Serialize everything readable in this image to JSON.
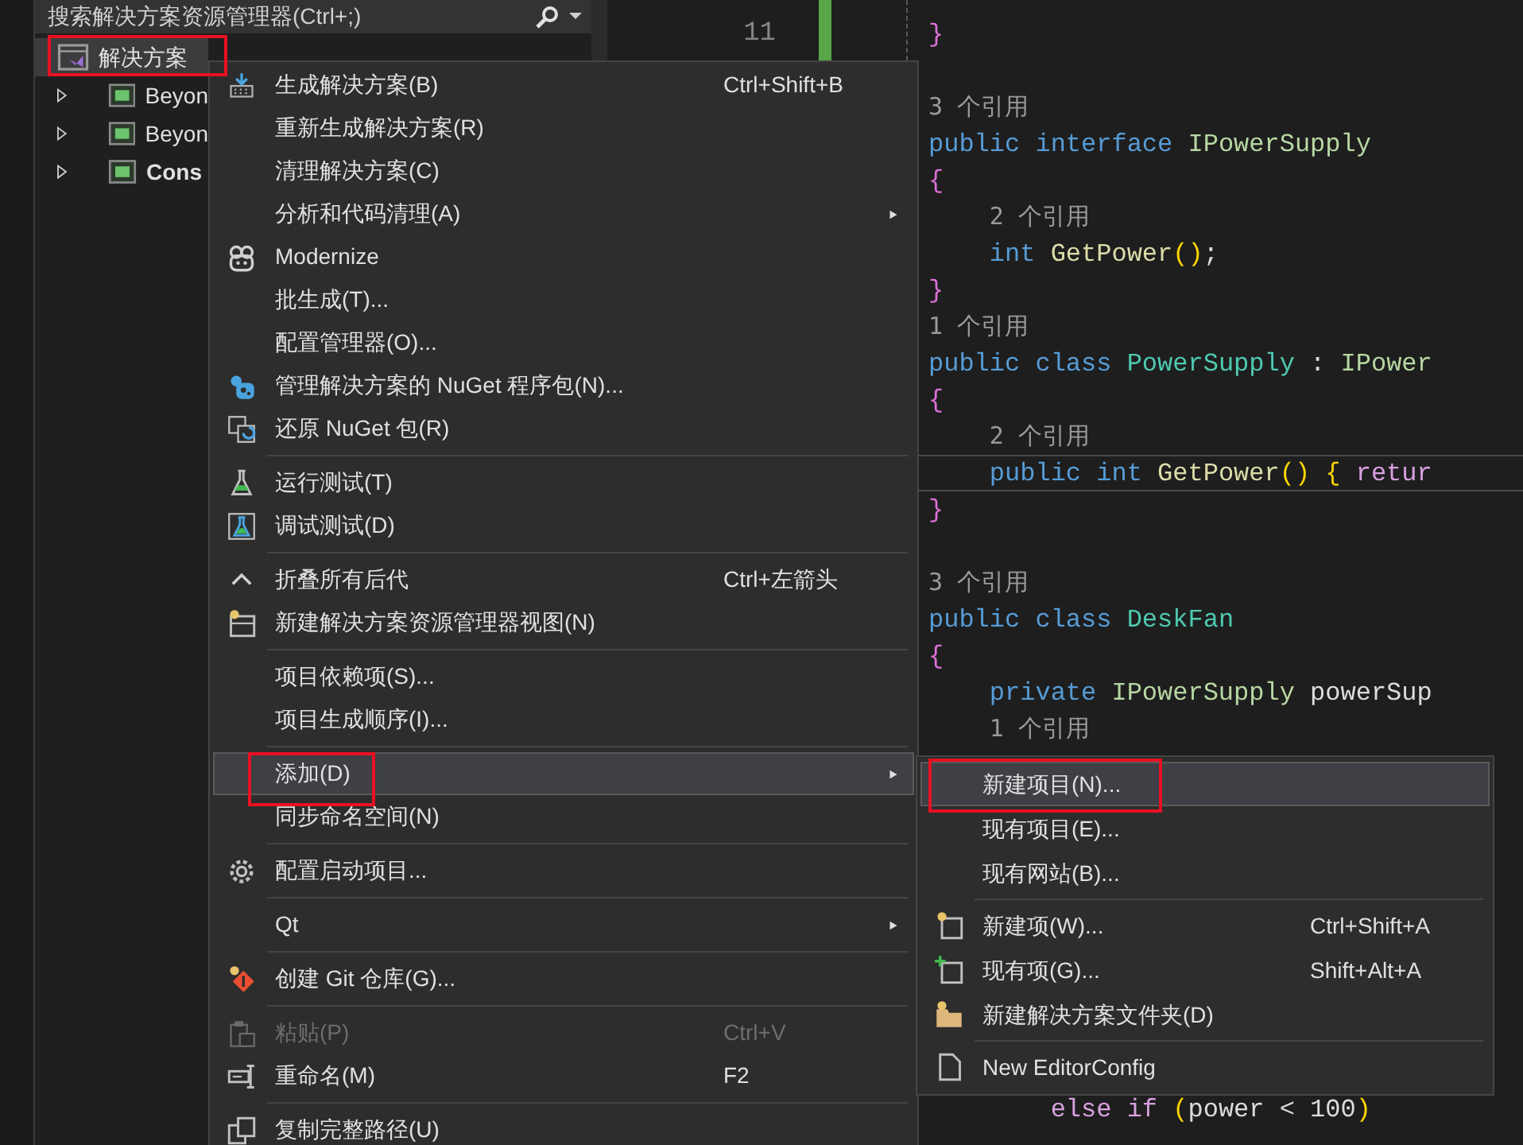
{
  "explorer": {
    "search": {
      "placeholder": "搜索解决方案资源管理器(Ctrl+;)"
    },
    "tree": [
      {
        "label": "解决方案",
        "selected": true,
        "bold": false,
        "children": [
          {
            "label": "Beyon",
            "selected": false,
            "expanded": false,
            "bold": false
          },
          {
            "label": "Beyon",
            "selected": false,
            "expanded": false,
            "bold": false
          },
          {
            "label": "Cons",
            "selected": false,
            "expanded": false,
            "bold": true
          }
        ]
      }
    ]
  },
  "editor": {
    "line_numbers": [
      "11"
    ],
    "lines": [
      {
        "kind": "code",
        "current": false,
        "tokens": [
          {
            "text": "}",
            "kind": "brace"
          }
        ]
      },
      {
        "kind": "blank",
        "current": false
      },
      {
        "kind": "codelens",
        "current": false,
        "text": "3 个引用"
      },
      {
        "kind": "code",
        "current": false,
        "tokens": [
          {
            "text": "public interface ",
            "kind": "keyword"
          },
          {
            "text": "IPowerSupply",
            "kind": "interface"
          }
        ]
      },
      {
        "kind": "code",
        "current": false,
        "tokens": [
          {
            "text": "{",
            "kind": "brace"
          }
        ]
      },
      {
        "kind": "codelens",
        "current": false,
        "text": "    2 个引用"
      },
      {
        "kind": "code",
        "current": false,
        "tokens": [
          {
            "text": "    int ",
            "kind": "keyword"
          },
          {
            "text": "GetPower",
            "kind": "method"
          },
          {
            "text": "()",
            "kind": "paren"
          },
          {
            "text": ";",
            "kind": "plain"
          }
        ]
      },
      {
        "kind": "code",
        "current": false,
        "tokens": [
          {
            "text": "}",
            "kind": "brace"
          }
        ]
      },
      {
        "kind": "codelens",
        "current": false,
        "text": "1 个引用"
      },
      {
        "kind": "code",
        "current": false,
        "tokens": [
          {
            "text": "public class ",
            "kind": "keyword"
          },
          {
            "text": "PowerSupply",
            "kind": "type"
          },
          {
            "text": " : ",
            "kind": "plain"
          },
          {
            "text": "IPower",
            "kind": "interface"
          }
        ]
      },
      {
        "kind": "code",
        "current": false,
        "tokens": [
          {
            "text": "{",
            "kind": "brace"
          }
        ]
      },
      {
        "kind": "codelens",
        "current": false,
        "text": "    2 个引用"
      },
      {
        "kind": "code",
        "current": true,
        "tokens": [
          {
            "text": "    public int ",
            "kind": "keyword"
          },
          {
            "text": "GetPower",
            "kind": "method"
          },
          {
            "text": "()",
            "kind": "paren"
          },
          {
            "text": " {",
            "kind": "paren"
          },
          {
            "text": " retur",
            "kind": "control"
          }
        ]
      },
      {
        "kind": "code",
        "current": false,
        "tokens": [
          {
            "text": "}",
            "kind": "brace"
          }
        ]
      },
      {
        "kind": "blank",
        "current": false
      },
      {
        "kind": "codelens",
        "current": false,
        "text": "3 个引用"
      },
      {
        "kind": "code",
        "current": false,
        "tokens": [
          {
            "text": "public class ",
            "kind": "keyword"
          },
          {
            "text": "DeskFan",
            "kind": "type"
          }
        ]
      },
      {
        "kind": "code",
        "current": false,
        "tokens": [
          {
            "text": "{",
            "kind": "brace"
          }
        ]
      },
      {
        "kind": "code",
        "current": false,
        "tokens": [
          {
            "text": "    private ",
            "kind": "keyword"
          },
          {
            "text": "IPowerSupply",
            "kind": "interface"
          },
          {
            "text": " powerSup",
            "kind": "plain"
          }
        ]
      },
      {
        "kind": "codelens",
        "current": false,
        "text": "    1 个引用"
      }
    ],
    "bottom_lines": [
      {
        "kind": "code",
        "current": false,
        "tokens": [
          {
            "text": "        else if ",
            "kind": "control"
          },
          {
            "text": "(",
            "kind": "paren"
          },
          {
            "text": "power < 100",
            "kind": "plain"
          },
          {
            "text": ")",
            "kind": "paren"
          }
        ]
      }
    ]
  },
  "context_menu": [
    {
      "kind": "item",
      "label": "生成解决方案(B)",
      "shortcut": "Ctrl+Shift+B",
      "submenu": false,
      "disabled": false,
      "selected": false
    },
    {
      "kind": "item",
      "label": "重新生成解决方案(R)",
      "submenu": false,
      "disabled": false,
      "selected": false
    },
    {
      "kind": "item",
      "label": "清理解决方案(C)",
      "submenu": false,
      "disabled": false,
      "selected": false
    },
    {
      "kind": "item",
      "label": "分析和代码清理(A)",
      "submenu": true,
      "disabled": false,
      "selected": false
    },
    {
      "kind": "item",
      "label": "Modernize",
      "submenu": false,
      "disabled": false,
      "selected": false
    },
    {
      "kind": "item",
      "label": "批生成(T)...",
      "submenu": false,
      "disabled": false,
      "selected": false
    },
    {
      "kind": "item",
      "label": "配置管理器(O)...",
      "submenu": false,
      "disabled": false,
      "selected": false
    },
    {
      "kind": "item",
      "label": "管理解决方案的 NuGet 程序包(N)...",
      "submenu": false,
      "disabled": false,
      "selected": false
    },
    {
      "kind": "item",
      "label": "还原 NuGet 包(R)",
      "submenu": false,
      "disabled": false,
      "selected": false
    },
    {
      "kind": "separator"
    },
    {
      "kind": "item",
      "label": "运行测试(T)",
      "submenu": false,
      "disabled": false,
      "selected": false
    },
    {
      "kind": "item",
      "label": "调试测试(D)",
      "submenu": false,
      "disabled": false,
      "selected": false
    },
    {
      "kind": "separator"
    },
    {
      "kind": "item",
      "label": "折叠所有后代",
      "shortcut": "Ctrl+左箭头",
      "submenu": false,
      "disabled": false,
      "selected": false
    },
    {
      "kind": "item",
      "label": "新建解决方案资源管理器视图(N)",
      "submenu": false,
      "disabled": false,
      "selected": false
    },
    {
      "kind": "separator"
    },
    {
      "kind": "item",
      "label": "项目依赖项(S)...",
      "submenu": false,
      "disabled": false,
      "selected": false
    },
    {
      "kind": "item",
      "label": "项目生成顺序(I)...",
      "submenu": false,
      "disabled": false,
      "selected": false
    },
    {
      "kind": "separator"
    },
    {
      "kind": "item",
      "label": "添加(D)",
      "submenu": true,
      "disabled": false,
      "selected": true
    },
    {
      "kind": "item",
      "label": "同步命名空间(N)",
      "submenu": false,
      "disabled": false,
      "selected": false
    },
    {
      "kind": "separator"
    },
    {
      "kind": "item",
      "label": "配置启动项目...",
      "submenu": false,
      "disabled": false,
      "selected": false
    },
    {
      "kind": "separator"
    },
    {
      "kind": "item",
      "label": "Qt",
      "submenu": true,
      "disabled": false,
      "selected": false
    },
    {
      "kind": "separator"
    },
    {
      "kind": "item",
      "label": "创建 Git 仓库(G)...",
      "submenu": false,
      "disabled": false,
      "selected": false
    },
    {
      "kind": "separator"
    },
    {
      "kind": "item",
      "label": "粘贴(P)",
      "shortcut": "Ctrl+V",
      "submenu": false,
      "disabled": true,
      "selected": false
    },
    {
      "kind": "item",
      "label": "重命名(M)",
      "shortcut": "F2",
      "submenu": false,
      "disabled": false,
      "selected": false
    },
    {
      "kind": "separator"
    },
    {
      "kind": "item",
      "label": "复制完整路径(U)",
      "submenu": false,
      "disabled": false,
      "selected": false
    }
  ],
  "add_submenu": [
    {
      "kind": "item",
      "label": "新建项目(N)...",
      "disabled": false,
      "selected": true
    },
    {
      "kind": "item",
      "label": "现有项目(E)...",
      "disabled": false,
      "selected": false
    },
    {
      "kind": "item",
      "label": "现有网站(B)...",
      "disabled": false,
      "selected": false
    },
    {
      "kind": "separator"
    },
    {
      "kind": "item",
      "label": "新建项(W)...",
      "shortcut": "Ctrl+Shift+A",
      "disabled": false,
      "selected": false
    },
    {
      "kind": "item",
      "label": "现有项(G)...",
      "shortcut": "Shift+Alt+A",
      "disabled": false,
      "selected": false
    },
    {
      "kind": "item",
      "label": "新建解决方案文件夹(D)",
      "disabled": false,
      "selected": false
    },
    {
      "kind": "separator"
    },
    {
      "kind": "item",
      "label": "New EditorConfig",
      "disabled": false,
      "selected": false
    }
  ]
}
